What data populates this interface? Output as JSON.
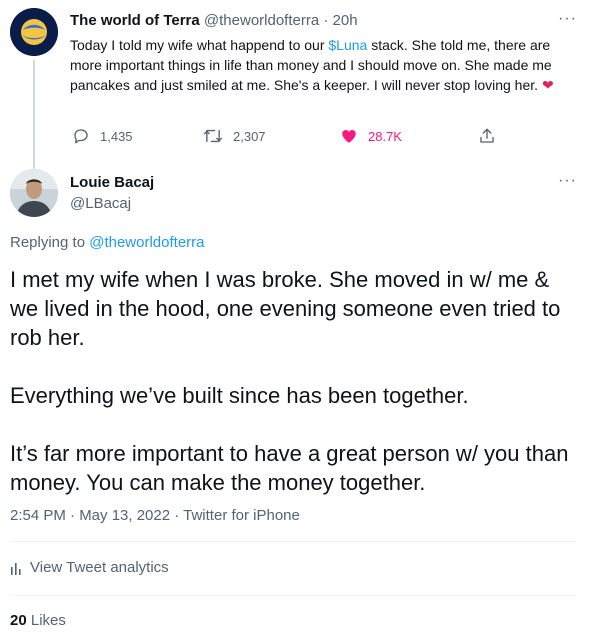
{
  "parent_tweet": {
    "display_name": "The world of Terra",
    "handle": "@theworldofterra",
    "separator": " · ",
    "time": "20h",
    "more": "···",
    "text_before": "Today I told my wife what happend to our ",
    "cashtag": "$Luna",
    "text_after": " stack. She told me, there are more important things in life than money and I should move on. She made me pancakes and just smiled at me. She's a keeper. I will never stop loving her. ",
    "emoji": "❤",
    "replies": "1,435",
    "retweets": "2,307",
    "likes": "28.7K",
    "icons": [
      "reply-icon",
      "retweet-icon",
      "like-icon",
      "share-icon"
    ],
    "like_color": "#f91880"
  },
  "reply_tweet": {
    "display_name": "Louie Bacaj",
    "handle": "@LBacaj",
    "more": "···",
    "replying_prefix": "Replying to ",
    "replying_to": "@theworldofterra",
    "paragraphs": [
      "I met my wife when I was broke. She moved in w/ me & we lived in the hood, one evening someone even tried to rob her.",
      "Everything we’ve built since has been together.",
      "It’s far more important to have a great person w/ you than money. You can make the money together."
    ],
    "meta": "2:54 PM · May 13, 2022 · Twitter for iPhone",
    "analytics_label": "View Tweet analytics",
    "likes_count": "20",
    "likes_label": "Likes"
  },
  "colors": {
    "accent": "#1d9bf0",
    "muted": "#536471",
    "text": "#0f1419",
    "terra_avatar_bg": "#0a1d4a"
  }
}
